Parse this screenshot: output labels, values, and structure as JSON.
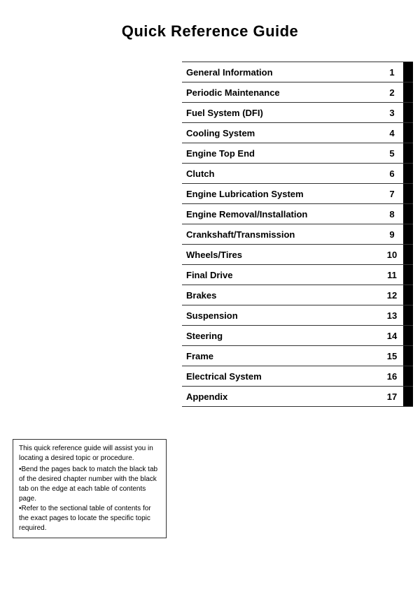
{
  "title": "Quick Reference Guide",
  "toc": {
    "items": [
      {
        "label": "General Information",
        "number": "1"
      },
      {
        "label": "Periodic Maintenance",
        "number": "2"
      },
      {
        "label": "Fuel System (DFI)",
        "number": "3"
      },
      {
        "label": "Cooling System",
        "number": "4"
      },
      {
        "label": "Engine Top End",
        "number": "5"
      },
      {
        "label": "Clutch",
        "number": "6"
      },
      {
        "label": "Engine Lubrication System",
        "number": "7"
      },
      {
        "label": "Engine Removal/Installation",
        "number": "8"
      },
      {
        "label": "Crankshaft/Transmission",
        "number": "9"
      },
      {
        "label": "Wheels/Tires",
        "number": "10"
      },
      {
        "label": "Final Drive",
        "number": "11"
      },
      {
        "label": "Brakes",
        "number": "12"
      },
      {
        "label": "Suspension",
        "number": "13"
      },
      {
        "label": "Steering",
        "number": "14"
      },
      {
        "label": "Frame",
        "number": "15"
      },
      {
        "label": "Electrical System",
        "number": "16"
      },
      {
        "label": "Appendix",
        "number": "17"
      }
    ]
  },
  "note": {
    "line1": "This quick reference guide will assist you in locating a desired topic or procedure.",
    "bullet1": "•Bend the pages back to match the black tab of the desired chapter number with the black tab on the edge at each table of contents page.",
    "bullet2": "•Refer to the sectional table of contents for the exact pages to locate the specific topic required."
  }
}
